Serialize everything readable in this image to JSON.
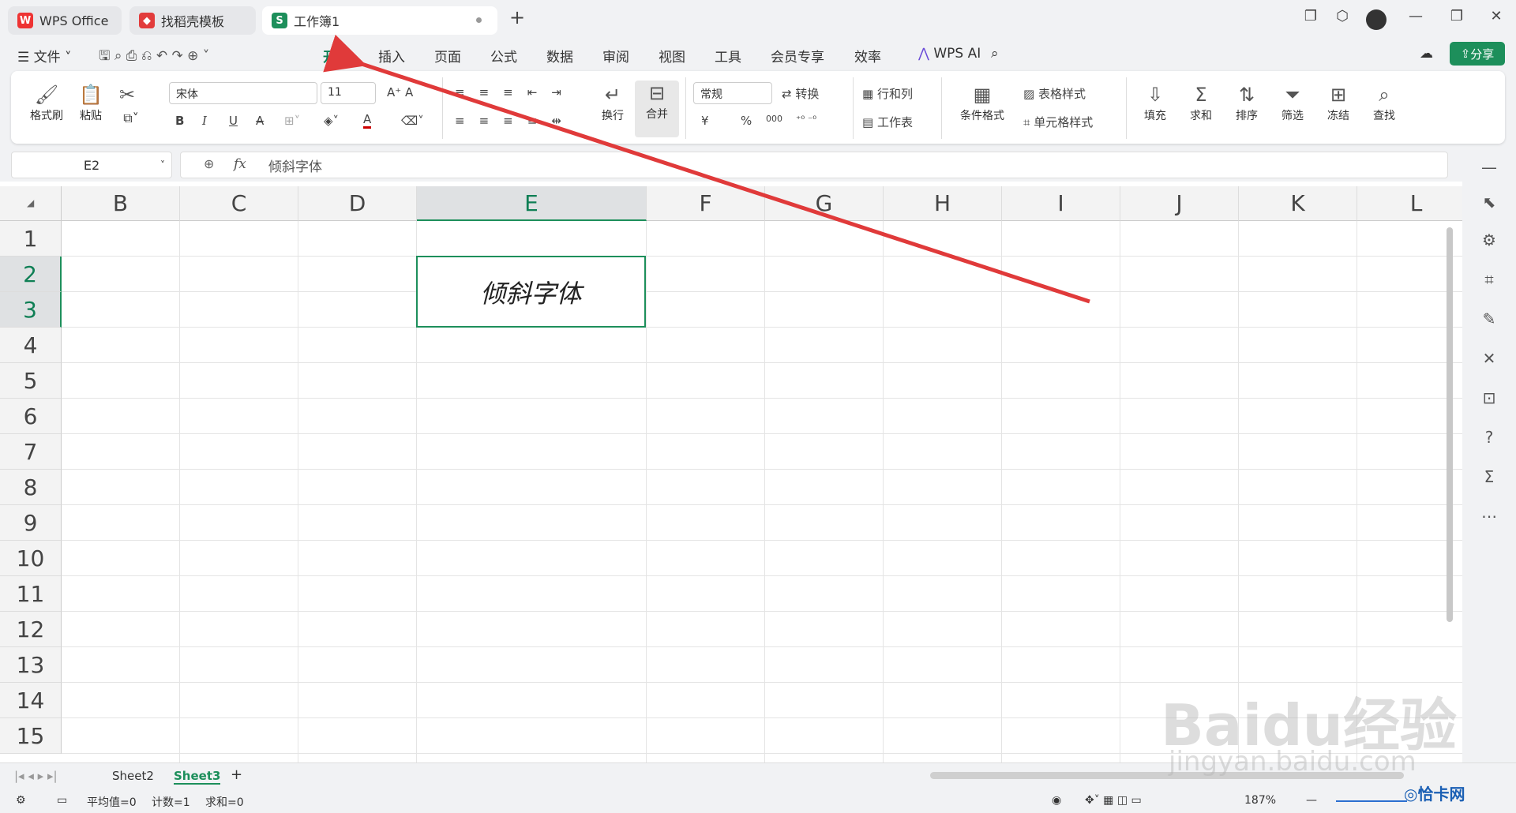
{
  "tabs": [
    {
      "label": "WPS Office"
    },
    {
      "label": "找稻壳模板"
    },
    {
      "label": "工作簿1"
    }
  ],
  "menu": [
    "文件",
    "开始",
    "插入",
    "页面",
    "公式",
    "数据",
    "审阅",
    "视图",
    "工具",
    "会员专享",
    "效率",
    "WPS AI"
  ],
  "share": "分享",
  "ribbon": {
    "format_painter": "格式刷",
    "paste": "粘贴",
    "font_name": "宋体",
    "font_size": "11",
    "wrap": "换行",
    "merge": "合并",
    "number_format": "常规",
    "convert": "转换",
    "rows_cols": "行和列",
    "worksheet": "工作表",
    "cond_format": "条件格式",
    "table_style": "表格样式",
    "cell_style": "单元格样式",
    "fill": "填充",
    "sum": "求和",
    "sort": "排序",
    "filter": "筛选",
    "freeze": "冻结",
    "find": "查找",
    "bold": "B",
    "italic": "I",
    "underline": "U",
    "strike": "A",
    "font_color": "A",
    "currency": "¥",
    "percent": "%",
    "thousand": "000"
  },
  "name_box": "E2",
  "formula": "倾斜字体",
  "fx": "fx",
  "columns": [
    "B",
    "C",
    "D",
    "E",
    "F",
    "G",
    "H",
    "I",
    "J",
    "K",
    "L"
  ],
  "rows": [
    "1",
    "2",
    "3",
    "4",
    "5",
    "6",
    "7",
    "8",
    "9",
    "10",
    "11",
    "12",
    "13",
    "14",
    "15"
  ],
  "cell_e2": "倾斜字体",
  "sheets": [
    "Sheet2",
    "Sheet3"
  ],
  "active_sheet": "Sheet3",
  "status": {
    "avg": "平均值=0",
    "count": "计数=1",
    "sum": "求和=0",
    "zoom": "187%"
  },
  "watermark": {
    "line1": "Baidu经验",
    "line2": "jingyan.baidu.com",
    "logo": "恰卡网"
  },
  "colors": {
    "accent": "#1d8f5b",
    "arrow": "#e03a3a"
  }
}
